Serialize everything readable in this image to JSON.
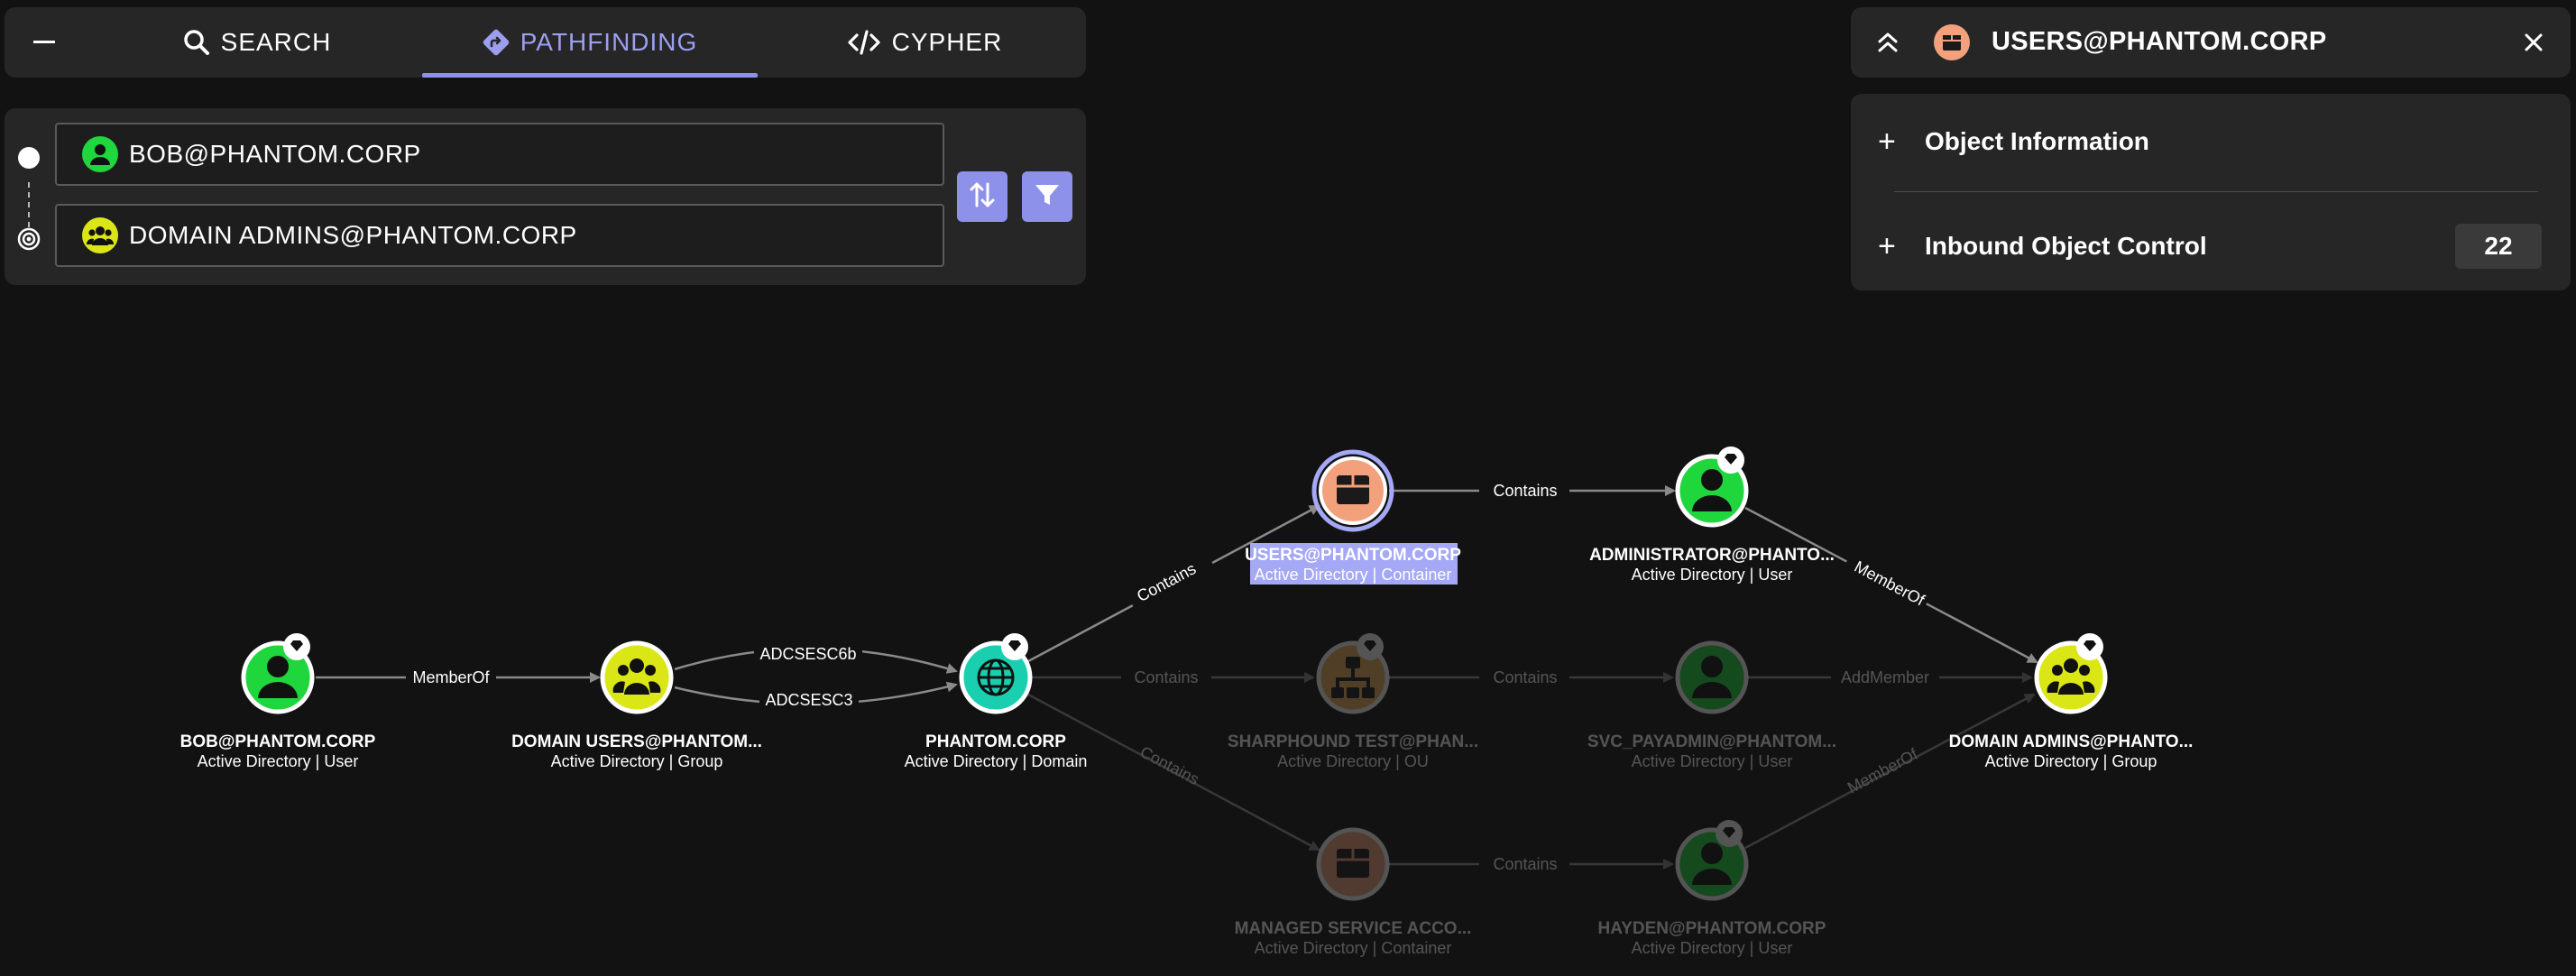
{
  "tabs": {
    "collapse_label": "",
    "search_label": "SEARCH",
    "pathfinding_label": "PATHFINDING",
    "cypher_label": "CYPHER"
  },
  "pathfinding": {
    "start_value": "BOB@PHANTOM.CORP",
    "end_value": "DOMAIN ADMINS@PHANTOM.CORP"
  },
  "entity_panel": {
    "title": "USERS@PHANTOM.CORP",
    "sections": [
      {
        "label": "Object Information"
      },
      {
        "label": "Inbound Object Control",
        "count": "22"
      }
    ]
  },
  "graph": {
    "nodes": [
      {
        "id": "bob",
        "name": "BOB@PHANTOM.CORP",
        "sub": "Active Directory | User",
        "kind": "user"
      },
      {
        "id": "du",
        "name": "DOMAIN USERS@PHANTOM...",
        "sub": "Active Directory | Group",
        "kind": "group"
      },
      {
        "id": "pc",
        "name": "PHANTOM.CORP",
        "sub": "Active Directory | Domain",
        "kind": "domain"
      },
      {
        "id": "users",
        "name": "USERS@PHANTOM.CORP",
        "sub": "Active Directory | Container",
        "kind": "container"
      },
      {
        "id": "admin",
        "name": "ADMINISTRATOR@PHANTO...",
        "sub": "Active Directory | User",
        "kind": "user"
      },
      {
        "id": "da",
        "name": "DOMAIN ADMINS@PHANTO...",
        "sub": "Active Directory | Group",
        "kind": "group"
      },
      {
        "id": "sht",
        "name": "SHARPHOUND TEST@PHAN...",
        "sub": "Active Directory | OU",
        "kind": "ou"
      },
      {
        "id": "svc",
        "name": "SVC_PAYADMIN@PHANTOM...",
        "sub": "Active Directory | User",
        "kind": "user"
      },
      {
        "id": "msa",
        "name": "MANAGED SERVICE ACCO...",
        "sub": "Active Directory | Container",
        "kind": "container"
      },
      {
        "id": "hayden",
        "name": "HAYDEN@PHANTOM.CORP",
        "sub": "Active Directory | User",
        "kind": "user"
      }
    ],
    "edges": [
      {
        "label": "MemberOf"
      },
      {
        "label": "ADCSESC6b"
      },
      {
        "label": "ADCSESC3"
      },
      {
        "label": "Contains"
      },
      {
        "label": "Contains"
      },
      {
        "label": "MemberOf"
      },
      {
        "label": "Contains"
      },
      {
        "label": "Contains"
      },
      {
        "label": "AddMember"
      },
      {
        "label": "Contains"
      },
      {
        "label": "Contains"
      },
      {
        "label": "MemberOf"
      }
    ]
  },
  "colors": {
    "accent": "#8e91ea",
    "user": "#20d63d",
    "group": "#dbe617",
    "domain": "#19cfb0",
    "container": "#f3a17c",
    "ou": "#f0b35a",
    "selection": "#a4a8f5"
  }
}
